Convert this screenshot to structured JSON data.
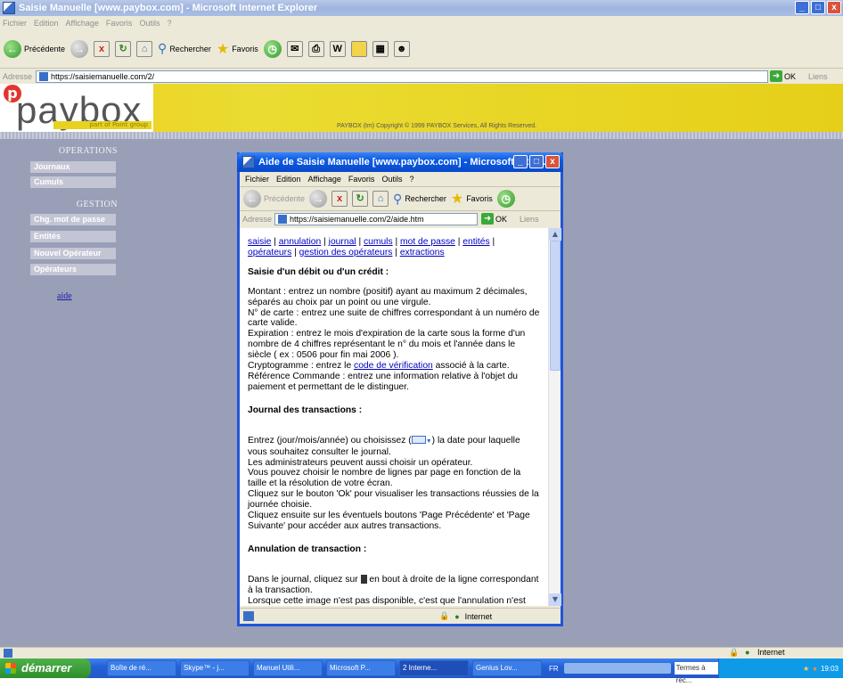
{
  "main_window": {
    "title": "Saisie Manuelle [www.paybox.com] - Microsoft Internet Explorer",
    "menu": [
      "Fichier",
      "Edition",
      "Affichage",
      "Favoris",
      "Outils",
      "?"
    ],
    "toolbar": {
      "back": "Précédente",
      "search": "Rechercher",
      "favorites": "Favoris"
    },
    "address_label": "Adresse",
    "url": "https://saisiemanuelle.com/2/",
    "go": "OK",
    "links": "Liens"
  },
  "banner": {
    "logo_text": "paybox",
    "logo_sub": "part of Point group",
    "copyright": "PAYBOX (tm) Copyright © 1999 PAYBOX Services, All Rights Reserved."
  },
  "sidebar": {
    "operations_title": "OPERATIONS",
    "operations": [
      "Journaux",
      "Cumuls"
    ],
    "gestion_title": "GESTION",
    "gestion": [
      "Chg. mot de passe",
      "Entités",
      "Nouvel Opérateur",
      "Opérateurs"
    ],
    "help_link": "aide"
  },
  "popup": {
    "title": "Aide de Saisie Manuelle [www.paybox.com] - Microsoft Inter...",
    "menu": [
      "Fichier",
      "Edition",
      "Affichage",
      "Favoris",
      "Outils",
      "?"
    ],
    "toolbar": {
      "back": "Précédente",
      "search": "Rechercher",
      "favorites": "Favoris"
    },
    "address_label": "Adresse",
    "url": "https://saisiemanuelle.com/2/aide.htm",
    "go": "OK",
    "links": "Liens",
    "nav_links": [
      "saisie",
      "annulation",
      "journal",
      "cumuls",
      "mot de passe",
      "entités",
      "opérateurs",
      "gestion des opérateurs",
      "extractions"
    ],
    "s1_title": "Saisie d'un débit ou d'un crédit",
    "s1_montant": "Montant : entrez un nombre (positif) ayant au maximum 2 décimales, séparés au choix par un point ou une virgule.",
    "s1_carte": "N° de carte : entrez une suite de chiffres correspondant à un numéro de carte valide.",
    "s1_expiration": "Expiration : entrez le mois d'expiration de la carte sous la forme d'un nombre de 4 chiffres représentant le n° du mois et l'année dans le siècle ( ex : 0506 pour fin mai 2006 ).",
    "s1_crypto_a": "Cryptogramme : entrez le",
    "s1_crypto_link": "code de vérification",
    "s1_crypto_b": "associé à la carte.",
    "s1_ref": "Référence Commande : entrez une information relative à l'objet du paiement et permettant de le distinguer.",
    "s2_title": "Journal des transactions",
    "s2_p1a": "Entrez (jour/mois/année) ou choisissez (",
    "s2_p1b": ") la date pour laquelle vous souhaitez consulter le journal.",
    "s2_p2": "Les administrateurs peuvent aussi choisir un opérateur.",
    "s2_p3": "Vous pouvez choisir le nombre de lignes par page en fonction de la taille et la résolution de votre écran.",
    "s2_p4": "Cliquez sur le bouton 'Ok' pour visualiser les transactions réussies de la journée choisie.",
    "s2_p5": "Cliquez ensuite sur les éventuels boutons 'Page Précédente' et 'Page Suivante' pour accéder aux autres transactions.",
    "s3_title": "Annulation de transaction",
    "s3_p1a": "Dans le journal, cliquez sur",
    "s3_p1b": "en bout à droite de la ligne correspondant à la transaction.",
    "s3_p2": "Lorsque cette image n'est pas disponible, c'est que l'annulation n'est pas",
    "zone": "Internet"
  },
  "statusbar": {
    "zone": "Internet"
  },
  "taskbar": {
    "start": "démarrer",
    "tasks": [
      "Boîte de ré...",
      "Skype™ - j...",
      "Manuel Utili...",
      "Microsoft P...",
      "2 Interne...",
      "Genius Lov..."
    ],
    "lang": "FR",
    "search_box": "Termes à rec...",
    "clock": "19:03"
  }
}
